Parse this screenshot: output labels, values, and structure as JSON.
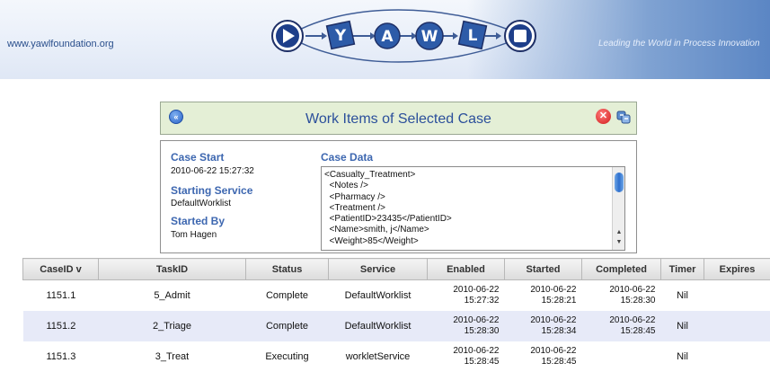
{
  "banner": {
    "site_url": "www.yawlfoundation.org",
    "tagline": "Leading the World in Process Innovation",
    "logo_letters": [
      "Y",
      "A",
      "W",
      "L"
    ]
  },
  "work_items": {
    "title": "Work Items of Selected Case",
    "back_icon": "back-arrow-icon",
    "close_icon": "close-icon",
    "refresh_icon": "refresh-icon"
  },
  "case": {
    "start_label": "Case Start",
    "start_value": "2010-06-22 15:27:32",
    "service_label": "Starting Service",
    "service_value": "DefaultWorklist",
    "started_by_label": "Started By",
    "started_by_value": "Tom Hagen",
    "data_label": "Case Data",
    "data_lines": [
      "<Casualty_Treatment>",
      "  <Notes />",
      "  <Pharmacy />",
      "  <Treatment />",
      "  <PatientID>23435</PatientID>",
      "  <Name>smith, j</Name>",
      "  <Weight>85</Weight>"
    ]
  },
  "table": {
    "headers": [
      "CaseID v",
      "TaskID",
      "Status",
      "Service",
      "Enabled",
      "Started",
      "Completed",
      "Timer",
      "Expires"
    ],
    "rows": [
      {
        "case_id": "1151.1",
        "task_id": "5_Admit",
        "status": "Complete",
        "service": "DefaultWorklist",
        "enabled_date": "2010-06-22",
        "enabled_time": "15:27:32",
        "started_date": "2010-06-22",
        "started_time": "15:28:21",
        "completed_date": "2010-06-22",
        "completed_time": "15:28:30",
        "timer": "Nil",
        "expires": ""
      },
      {
        "case_id": "1151.2",
        "task_id": "2_Triage",
        "status": "Complete",
        "service": "DefaultWorklist",
        "enabled_date": "2010-06-22",
        "enabled_time": "15:28:30",
        "started_date": "2010-06-22",
        "started_time": "15:28:34",
        "completed_date": "2010-06-22",
        "completed_time": "15:28:45",
        "timer": "Nil",
        "expires": ""
      },
      {
        "case_id": "1151.3",
        "task_id": "3_Treat",
        "status": "Executing",
        "service": "workletService",
        "enabled_date": "2010-06-22",
        "enabled_time": "15:28:45",
        "started_date": "2010-06-22",
        "started_time": "15:28:45",
        "completed_date": "",
        "completed_time": "",
        "timer": "Nil",
        "expires": ""
      }
    ]
  },
  "colors": {
    "accent_blue": "#3d67b0",
    "header_panel_bg": "#e4efd6",
    "alt_row_bg": "#e7eaf8"
  }
}
